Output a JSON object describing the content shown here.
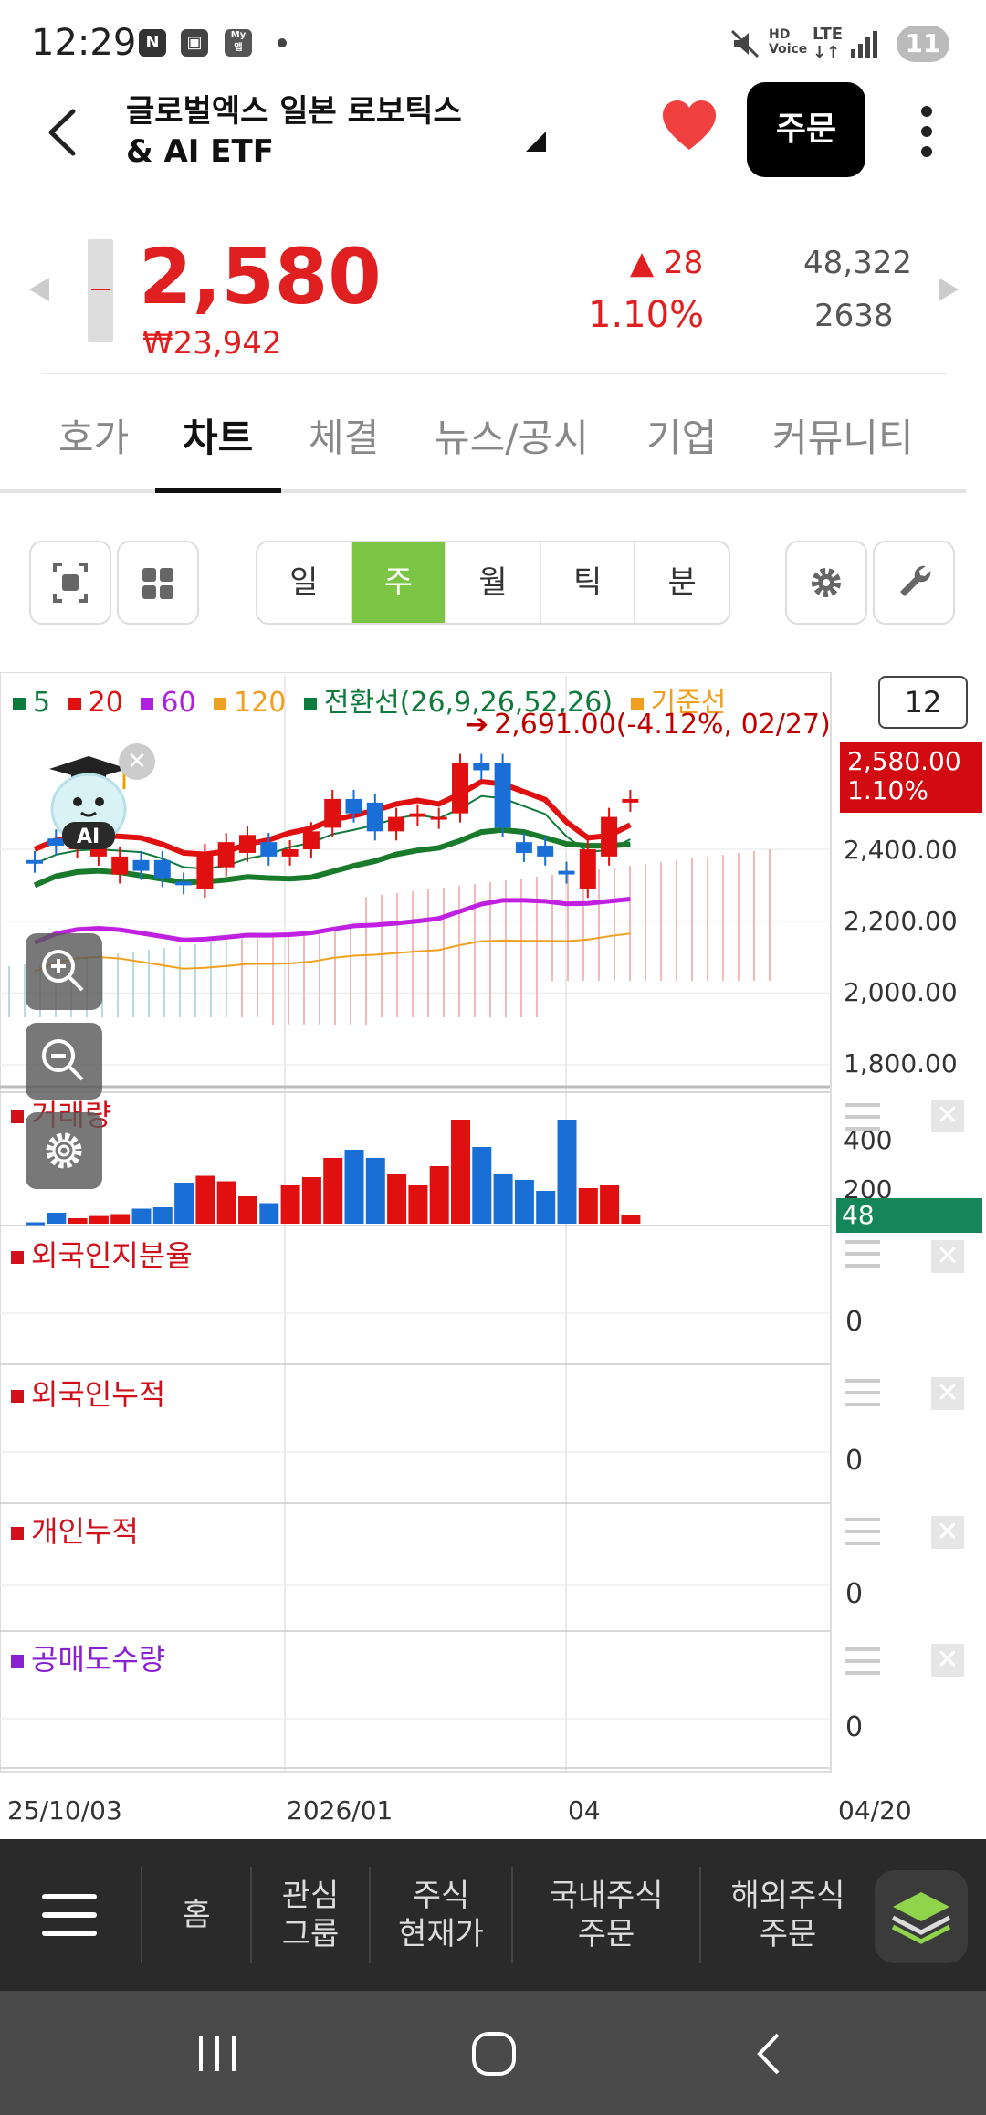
{
  "status_bar": {
    "time": "12:29",
    "icons": [
      "n-icon",
      "screenshot-icon",
      "insurance-app-icon",
      "dot-icon"
    ],
    "right": [
      "mute-icon",
      "hd-voice-icon",
      "lte-icon",
      "signal-icon"
    ],
    "battery": "11"
  },
  "header": {
    "title_line1": "글로벌엑스 일본 로보틱스",
    "title_line2": "& AI ETF",
    "order_label": "주문"
  },
  "quote": {
    "price": "2,580",
    "krw_price": "₩23,942",
    "change": "▲ 28",
    "change_pct": "1.10%",
    "volume": "48,322",
    "value2": "2638",
    "up_color": "#e02020"
  },
  "tabs": [
    "호가",
    "차트",
    "체결",
    "뉴스/공시",
    "기업",
    "커뮤니티"
  ],
  "active_tab": "차트",
  "period_buttons": [
    "일",
    "주",
    "월",
    "틱",
    "분"
  ],
  "active_period": "주",
  "chart": {
    "legend": [
      {
        "label": "5",
        "color": "#0f7a3c"
      },
      {
        "label": "20",
        "color": "#e01010"
      },
      {
        "label": "60",
        "color": "#b020e0"
      },
      {
        "label": "120",
        "color": "#f0a020"
      },
      {
        "label": "전환선(26,9,26,52,26)",
        "color": "#0f7a3c"
      },
      {
        "label": "기준선",
        "color": "#f0a020"
      }
    ],
    "page_count": "12",
    "high_annotation": "2,691.00(-4.12%, 02/27)",
    "current_tag_price": "2,580.00",
    "current_tag_pct": "1.10%",
    "price_axis": [
      "2,400.00",
      "2,200.00",
      "2,000.00",
      "1,800.00"
    ],
    "volume_axis": [
      "400",
      "200"
    ],
    "volume_tag": "48",
    "panels": [
      {
        "title": "거래량",
        "color": "#d0101a"
      },
      {
        "title": "외국인지분율",
        "color": "#d0101a",
        "zero": "0"
      },
      {
        "title": "외국인누적",
        "color": "#d0101a",
        "zero": "0"
      },
      {
        "title": "개인누적",
        "color": "#d0101a",
        "zero": "0"
      },
      {
        "title": "공매도수량",
        "color": "#8a20d0",
        "zero": "0"
      }
    ],
    "date_labels": [
      "25/10/03",
      "2026/01",
      "04",
      "04/20"
    ],
    "ai_badge": "AI"
  },
  "chart_data": {
    "type": "candlestick",
    "x": [
      "25/10/03",
      "25/10/10",
      "25/10/17",
      "25/10/24",
      "25/10/31",
      "25/11/07",
      "25/11/14",
      "25/11/21",
      "25/11/28",
      "25/12/05",
      "25/12/12",
      "25/12/19",
      "25/12/26",
      "26/01/02",
      "26/01/09",
      "26/01/16",
      "26/01/23",
      "26/01/30",
      "26/02/06",
      "26/02/13",
      "26/02/20",
      "26/02/27",
      "26/03/06",
      "26/03/13",
      "26/03/20",
      "26/03/27",
      "26/04/03",
      "26/04/10",
      "26/04/17"
    ],
    "open": [
      2370,
      2430,
      2400,
      2380,
      2330,
      2370,
      2370,
      2310,
      2290,
      2350,
      2390,
      2420,
      2380,
      2400,
      2460,
      2540,
      2530,
      2450,
      2490,
      2490,
      2500,
      2640,
      2640,
      2420,
      2410,
      2340,
      2290,
      2380,
      2530
    ],
    "close": [
      2360,
      2410,
      2420,
      2410,
      2380,
      2340,
      2320,
      2300,
      2390,
      2420,
      2440,
      2380,
      2400,
      2450,
      2540,
      2500,
      2450,
      2490,
      2500,
      2490,
      2640,
      2620,
      2460,
      2390,
      2380,
      2330,
      2400,
      2490,
      2540
    ],
    "volume": [
      5,
      40,
      20,
      28,
      35,
      55,
      60,
      150,
      175,
      155,
      100,
      75,
      140,
      170,
      240,
      270,
      240,
      180,
      140,
      210,
      380,
      280,
      180,
      160,
      120,
      380,
      130,
      140,
      30
    ],
    "ylim": [
      1800,
      2700
    ],
    "volume_ylim": [
      0,
      400
    ]
  },
  "bottom_nav": [
    "홈",
    "관심\n그룹",
    "주식\n현재가",
    "국내주식\n주문",
    "해외주식\n주문"
  ]
}
